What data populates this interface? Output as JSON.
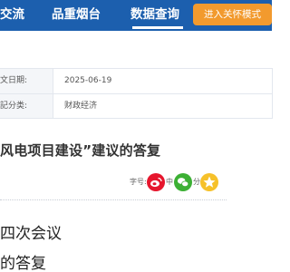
{
  "nav": {
    "items": [
      {
        "label": "交流"
      },
      {
        "label": "品重烟台"
      },
      {
        "label": "数据查询"
      }
    ],
    "care_mode_button": "进入关怀模式",
    "active_color": "#1c5fae",
    "button_color": "#f29a2e"
  },
  "meta": {
    "rows": [
      {
        "label": "文日期:",
        "value": "2025-06-19"
      },
      {
        "label": "記分类:",
        "value": "财政经济"
      }
    ]
  },
  "article": {
    "title": "风电项目建设”建议的答复",
    "font_size_label": "字号:",
    "font_sizes": [
      "大",
      "中",
      "小"
    ],
    "share_label": "分享:",
    "share_icons": [
      "weibo-icon",
      "wechat-icon",
      "qzone-icon"
    ],
    "body_lines": [
      "四次会议",
      "的答复"
    ]
  }
}
